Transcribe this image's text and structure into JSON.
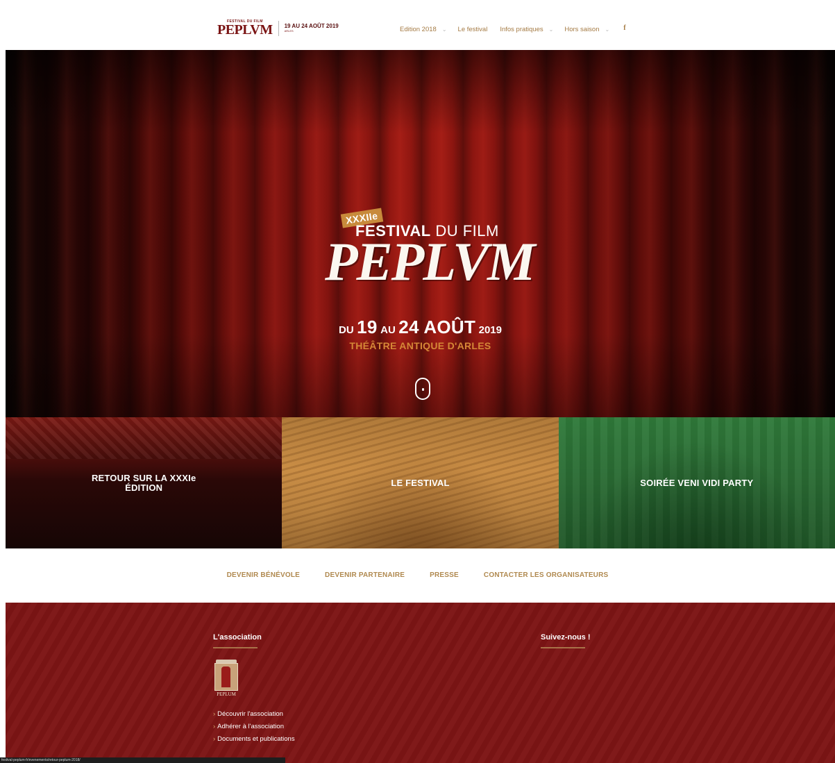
{
  "header": {
    "logo_top": "FESTIVAL DU FILM",
    "logo_name": "PEPLVM",
    "logo_date": "19 AU 24 AOÛT 2019",
    "logo_city": "ARLES"
  },
  "nav": {
    "items": [
      {
        "label": "Edition 2018",
        "has_dropdown": true
      },
      {
        "label": "Le festival",
        "has_dropdown": false
      },
      {
        "label": "Infos pratiques",
        "has_dropdown": true
      },
      {
        "label": "Hors saison",
        "has_dropdown": true
      }
    ],
    "facebook_glyph": "f"
  },
  "hero": {
    "badge": "XXXIIe",
    "festival": "FESTIVAL",
    "du_film": "DU FILM",
    "title": "PEPLVM",
    "du": "DU",
    "day1": "19",
    "au": "AU",
    "day2": "24 AOÛT",
    "year": "2019",
    "place": "THÉÂTRE ANTIQUE D'ARLES"
  },
  "tiles": [
    {
      "label_line1": "RETOUR SUR LA XXXIe",
      "label_line2": "ÉDITION"
    },
    {
      "label_line1": "LE FESTIVAL",
      "label_line2": ""
    },
    {
      "label_line1": "SOIRÉE VENI VIDI PARTY",
      "label_line2": ""
    }
  ],
  "links": [
    "DEVENIR BÉNÉVOLE",
    "DEVENIR PARTENAIRE",
    "PRESSE",
    "CONTACTER LES ORGANISATEURS"
  ],
  "footer": {
    "association_title": "L'association",
    "association_logo_word": "PEPLUM",
    "association_links": [
      "Découvrir l'association",
      "Adhérer à l'association",
      "Documents et publications"
    ],
    "follow_title": "Suivez-nous !"
  },
  "status_bar": "festival-peplum-fr/evenements/retour-peplum-2018/",
  "colors": {
    "brand_red": "#7d1515",
    "gold": "#a47a43",
    "tile_red": "#4f0f0c",
    "tile_gold": "#c98d45",
    "tile_green": "#2a6b33",
    "hero_orange": "#d58837"
  }
}
